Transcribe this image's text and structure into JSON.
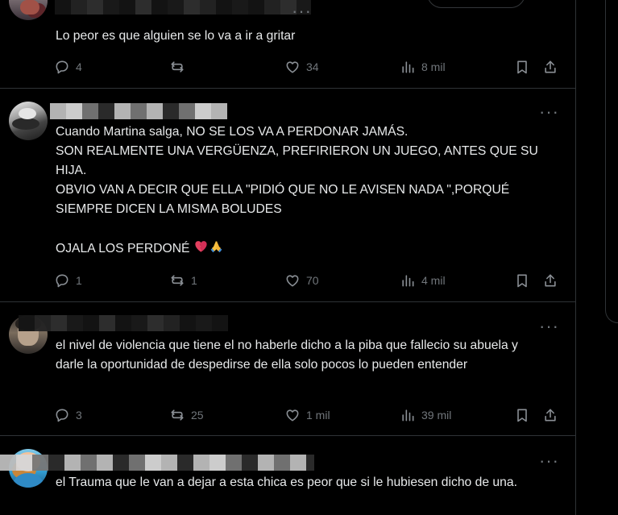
{
  "tweets": [
    {
      "text": "Lo peor es que alguien se lo va a ir a gritar",
      "reply_count": "4",
      "repost_count": "",
      "like_count": "34",
      "view_count": "8 mil"
    },
    {
      "text": "Cuando Martina salga, NO SE LOS VA A PERDONAR JAMÁS.\nSON REALMENTE UNA VERGÜENZA, PREFIRIERON UN JUEGO, ANTES QUE SU HIJA.\nOBVIO VAN A DECIR QUE ELLA \"PIDIÓ QUE NO LE AVISEN NADA \",PORQUÉ SIEMPRE DICEN LA MISMA BOLUDES\n\nOJALA LOS PERDONÉ",
      "reply_count": "1",
      "repost_count": "1",
      "like_count": "70",
      "view_count": "4 mil"
    },
    {
      "text": "el nivel de violencia que tiene el no haberle dicho a la piba que fallecio su abuela y darle la oportunidad de despedirse de ella solo pocos lo pueden entender",
      "reply_count": "3",
      "repost_count": "25",
      "like_count": "1 mil",
      "view_count": "39 mil"
    },
    {
      "text": "el Trauma que le van a dejar a esta chica es peor que si le hubiesen dicho de una."
    }
  ],
  "icons": {
    "reply": "reply-icon",
    "repost": "repost-icon",
    "like": "heart-icon",
    "views": "views-icon",
    "bookmark": "bookmark-icon",
    "share": "share-icon",
    "more": "more-icon",
    "broken_heart": "broken-heart-icon",
    "praying_hands": "praying-hands-icon"
  },
  "colors": {
    "background": "#000000",
    "text": "#e7e9ea",
    "muted": "#71767b",
    "divider": "#2f3336"
  }
}
